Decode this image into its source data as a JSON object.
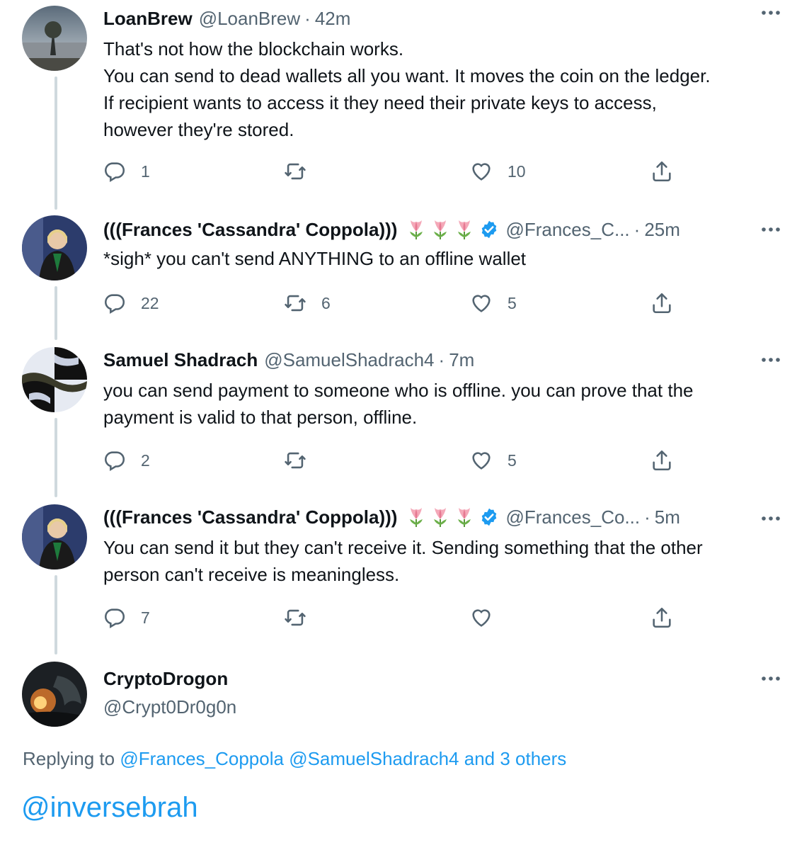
{
  "colors": {
    "accent": "#1d9bf0",
    "muted": "#536471",
    "text": "#0f1419",
    "thread_line": "#cfd9de"
  },
  "tweets": [
    {
      "name": "LoanBrew",
      "handle": "@LoanBrew",
      "dot": "·",
      "time": "42m",
      "lines": [
        "That's not how the blockchain works.",
        "You can send to dead wallets all you want. It moves the coin on the ledger.",
        "If recipient wants to access it they need their private keys to access,",
        "however they're stored."
      ],
      "replies": "1",
      "retweets": "",
      "likes": "10"
    },
    {
      "name": "(((Frances 'Cassandra' Coppola)))",
      "handle": "@Frances_C...",
      "dot": "·",
      "time": "25m",
      "badges": [
        "tulip-icon",
        "tulip-icon",
        "tulip-icon",
        "verified-badge-icon"
      ],
      "lines": [
        "*sigh* you can't send ANYTHING to an offline wallet"
      ],
      "replies": "22",
      "retweets": "6",
      "likes": "5"
    },
    {
      "name": "Samuel Shadrach",
      "handle": "@SamuelShadrach4",
      "dot": "·",
      "time": "7m",
      "lines": [
        "you can send payment to someone who is offline. you can prove that the",
        "payment is valid to that person, offline."
      ],
      "replies": "2",
      "retweets": "",
      "likes": "5"
    },
    {
      "name": "(((Frances 'Cassandra' Coppola)))",
      "handle": "@Frances_Co...",
      "dot": "·",
      "time": "5m",
      "badges": [
        "tulip-icon",
        "tulip-icon",
        "tulip-icon",
        "verified-badge-icon"
      ],
      "lines": [
        "You can send it but they can't receive it. Sending something that the other",
        "person can't receive is meaningless."
      ],
      "replies": "7",
      "retweets": "",
      "likes": ""
    }
  ],
  "composer": {
    "name": "CryptoDrogon",
    "handle": "@Crypt0Dr0g0n",
    "replying_prefix": "Replying to",
    "mention_1": "@Frances_Coppola",
    "mention_2": "@SamuelShadrach4",
    "and_others": "and 3 others",
    "reply_text": "@inversebrah"
  },
  "icons": {
    "reply": "reply-icon",
    "retweet": "retweet-icon",
    "like": "heart-icon",
    "share": "share-icon",
    "more": "more-options-icon"
  }
}
